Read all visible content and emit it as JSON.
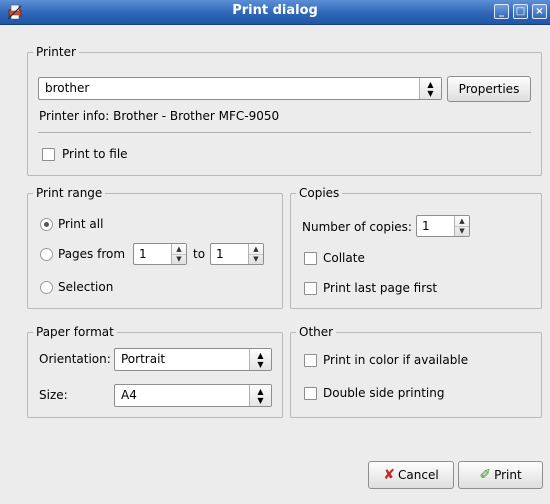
{
  "window": {
    "title": "Print dialog",
    "controls": {
      "minimize": "_",
      "maximize": "□",
      "close": "×"
    }
  },
  "printer": {
    "legend": "Printer",
    "selected": "brother",
    "properties_label": "Properties",
    "info": "Printer info: Brother - Brother MFC-9050",
    "print_to_file_label": "Print to file",
    "print_to_file_checked": false
  },
  "print_range": {
    "legend": "Print range",
    "print_all_label": "Print all",
    "pages_from_label": "Pages from",
    "from_value": "1",
    "to_label": "to",
    "to_value": "1",
    "selection_label": "Selection",
    "selected_option": "print-all"
  },
  "copies": {
    "legend": "Copies",
    "number_label": "Number of copies:",
    "number_value": "1",
    "collate_label": "Collate",
    "collate_checked": false,
    "last_first_label": "Print last page first",
    "last_first_checked": false
  },
  "paper_format": {
    "legend": "Paper format",
    "orientation_label": "Orientation:",
    "orientation_value": "Portrait",
    "size_label": "Size:",
    "size_value": "A4"
  },
  "other": {
    "legend": "Other",
    "color_label": "Print in color if available",
    "color_checked": false,
    "duplex_label": "Double side printing",
    "duplex_checked": false
  },
  "actions": {
    "cancel_label": "Cancel",
    "print_label": "Print"
  },
  "colors": {
    "titlebar": "#2f66b8",
    "window_bg": "#ececec",
    "cancel_icon": "#c62828",
    "print_icon": "#4b8f2e"
  }
}
